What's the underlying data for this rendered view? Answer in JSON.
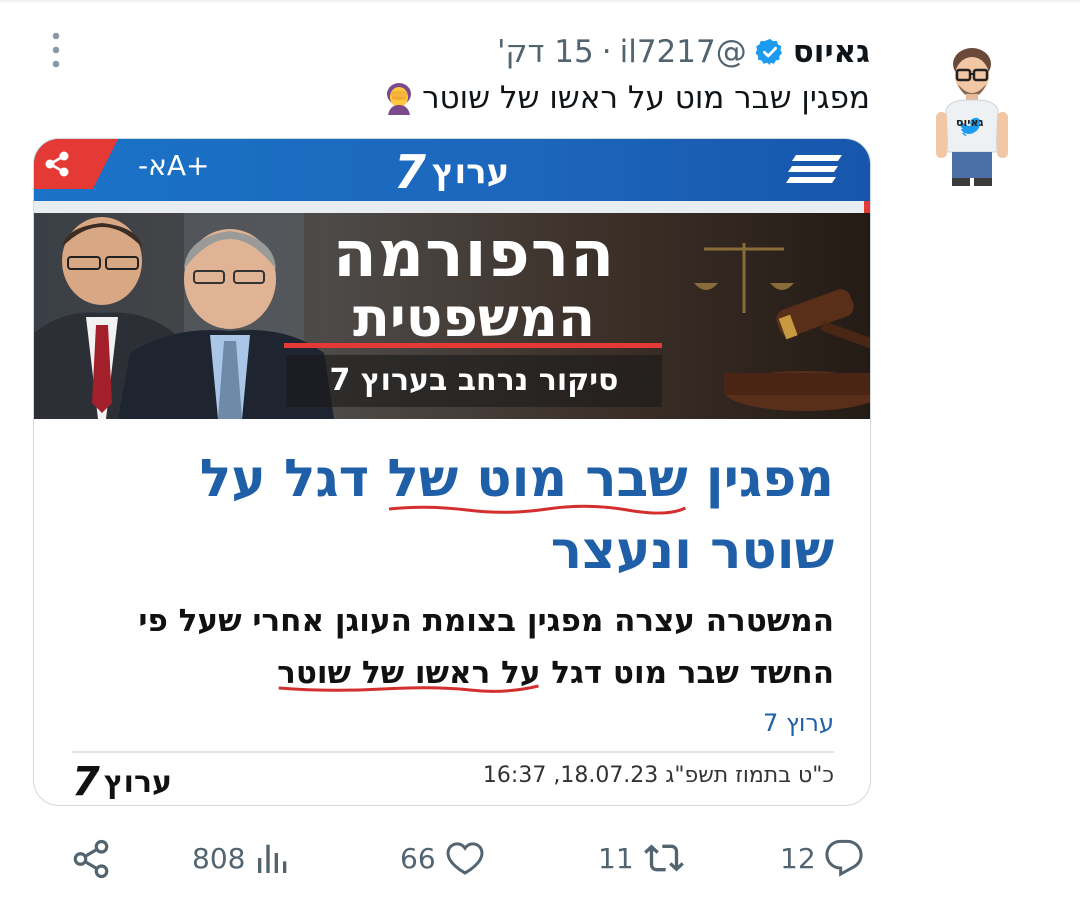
{
  "tweet": {
    "author_name": "גאיוס",
    "handle": "@il7217",
    "separator": "·",
    "time": "15 דק'",
    "text": "מפגין שבר מוט על ראשו של שוטר",
    "emoji": "🤦‍♀️",
    "avatar_shirt_text": "גאיוס"
  },
  "card": {
    "site_logo": "ערוץ",
    "site_logo_num": "7",
    "font_controls": "-אA+",
    "banner": {
      "line1": "הרפורמה",
      "line2": "המשפטית",
      "subtitle": "סיקור נרחב בערוץ 7"
    },
    "headline_line1_before": "מפגין ",
    "headline_line1_underlined": "שבר מוט של",
    "headline_line1_after": " דגל על",
    "headline_line2": "שוטר ונעצר",
    "description_line1": "המשטרה עצרה מפגין בצומת העוגן אחרי שעל פי",
    "description_line2_before": "החשד שבר מוט דגל ",
    "description_line2_underlined": "על ראשו של שוטר",
    "source": "ערוץ 7",
    "footer_logo": "ערוץ",
    "footer_logo_num": "7",
    "footer_date": "כ\"ט בתמוז תשפ\"ג 18.07.23, 16:37"
  },
  "actions": {
    "replies": "12",
    "retweets": "11",
    "likes": "66",
    "views": "808"
  },
  "colors": {
    "verified": "#1d9bf0",
    "headline": "#1f5fa8",
    "muted": "#536471",
    "underline": "#d32f2f"
  }
}
